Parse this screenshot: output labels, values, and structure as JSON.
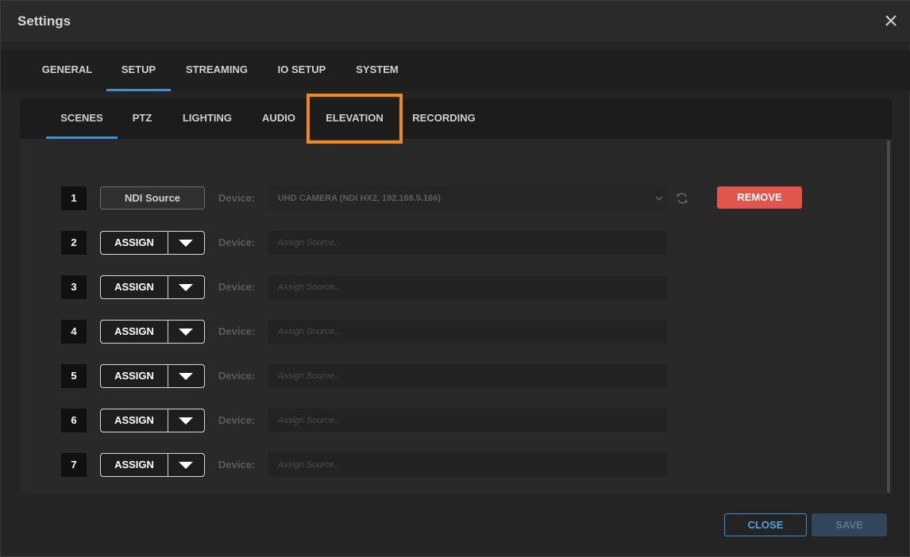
{
  "window": {
    "title": "Settings",
    "close_icon": "close-icon"
  },
  "main_tabs": [
    {
      "label": "GENERAL",
      "active": false
    },
    {
      "label": "SETUP",
      "active": true
    },
    {
      "label": "STREAMING",
      "active": false
    },
    {
      "label": "IO SETUP",
      "active": false
    },
    {
      "label": "SYSTEM",
      "active": false
    }
  ],
  "sub_tabs": [
    {
      "label": "SCENES",
      "active": true
    },
    {
      "label": "PTZ",
      "active": false
    },
    {
      "label": "LIGHTING",
      "active": false
    },
    {
      "label": "AUDIO",
      "active": false
    },
    {
      "label": "ELEVATION",
      "active": false,
      "highlighted": true
    },
    {
      "label": "RECORDING",
      "active": false
    }
  ],
  "scenes": {
    "device_label": "Device:",
    "rows": [
      {
        "number": "1",
        "source_button": "NDI Source",
        "device_value": "UHD CAMERA (NDI HX2, 192.168.5.166)",
        "remove_label": "REMOVE"
      },
      {
        "number": "2",
        "assign_label": "ASSIGN",
        "placeholder": "Assign Source..."
      },
      {
        "number": "3",
        "assign_label": "ASSIGN",
        "placeholder": "Assign Source..."
      },
      {
        "number": "4",
        "assign_label": "ASSIGN",
        "placeholder": "Assign Source..."
      },
      {
        "number": "5",
        "assign_label": "ASSIGN",
        "placeholder": "Assign Source..."
      },
      {
        "number": "6",
        "assign_label": "ASSIGN",
        "placeholder": "Assign Source..."
      },
      {
        "number": "7",
        "assign_label": "ASSIGN",
        "placeholder": "Assign Source..."
      }
    ]
  },
  "footer": {
    "close_label": "CLOSE",
    "save_label": "SAVE"
  },
  "colors": {
    "accent_blue": "#3d8fd6",
    "highlight_orange": "#f08a1f",
    "remove_red": "#e2554d"
  }
}
